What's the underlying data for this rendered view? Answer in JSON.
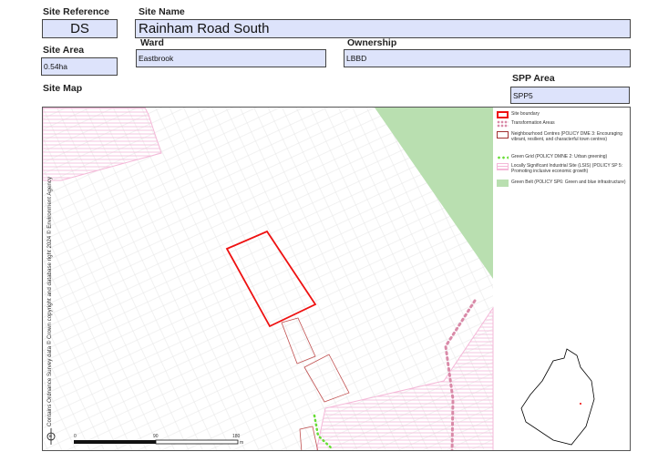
{
  "header": {
    "site_reference_label": "Site Reference",
    "site_reference": "DS",
    "site_name_label": "Site Name",
    "site_name": "Rainham Road South",
    "site_area_label": "Site Area",
    "site_area": "0.54ha",
    "ward_label": "Ward",
    "ward": "Eastbrook",
    "ownership_label": "Ownership",
    "ownership": "LBBD",
    "spp_area_label": "SPP Area",
    "spp_area": "SPP5",
    "site_map_label": "Site Map"
  },
  "legend": [
    {
      "label": "Site boundary"
    },
    {
      "label": "Transformation Areas"
    },
    {
      "label": "Neighbourhood Centres (POLICY DME 3: Encouraging vibrant, resilient, and characterful town centres)"
    },
    {
      "label": "Green Grid (POLICY DMNE 2: Urban greening)"
    },
    {
      "label": "Locally Significant Industrial Site (LSIS) (POLICY SP 5: Promoting inclusive economic growth)"
    },
    {
      "label": "Green Belt (POLICY SP6: Green and blue infrastructure)"
    }
  ],
  "colors": {
    "site": "#ee1111",
    "transformation": "#d98aa8",
    "green_grid": "#66dd33",
    "lsis": "#f4b8d8",
    "green_belt": "#b9dfb0",
    "field": "#dde3fb"
  },
  "map": {
    "credit": "Contains Ordnance Survey data © Crown copyright and database right 2024 © Environment Agency",
    "scale": {
      "ticks": [
        "0",
        "90",
        "180"
      ],
      "unit": "m"
    },
    "north": "N"
  }
}
